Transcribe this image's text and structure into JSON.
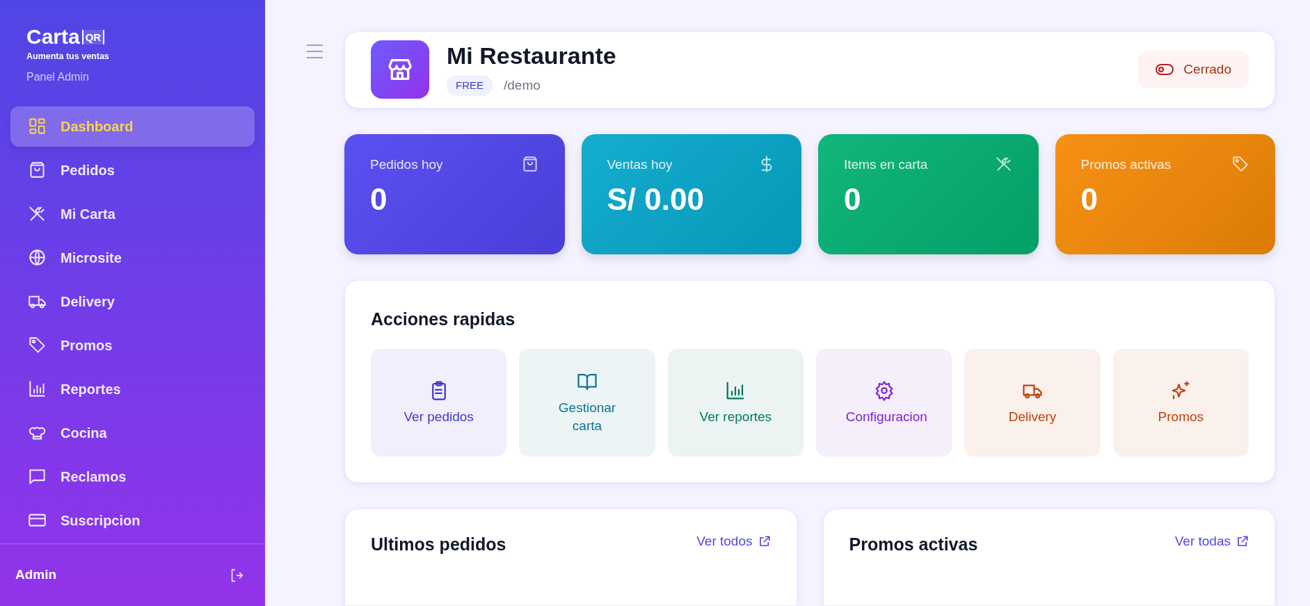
{
  "sidebar": {
    "logo": {
      "name": "Carta",
      "mark": "QR",
      "tagline": "Aumenta tus ventas"
    },
    "subtitle": "Panel Admin",
    "items": [
      {
        "label": "Dashboard",
        "selected": true
      },
      {
        "label": "Pedidos",
        "selected": false
      },
      {
        "label": "Mi Carta",
        "selected": false
      },
      {
        "label": "Microsite",
        "selected": false
      },
      {
        "label": "Delivery",
        "selected": false
      },
      {
        "label": "Promos",
        "selected": false
      },
      {
        "label": "Reportes",
        "selected": false
      },
      {
        "label": "Cocina",
        "selected": false
      },
      {
        "label": "Reclamos",
        "selected": false
      },
      {
        "label": "Suscripcion",
        "selected": false
      }
    ],
    "footer": {
      "user": "Admin"
    }
  },
  "header": {
    "title": "Mi Restaurante",
    "plan": "FREE",
    "slug": "/demo",
    "status": {
      "label": "Cerrado",
      "open": false
    }
  },
  "stats": [
    {
      "label": "Pedidos hoy",
      "value": "0",
      "color": "#5046f0"
    },
    {
      "label": "Ventas hoy",
      "value": "S/ 0.00",
      "color": "#06a8cc"
    },
    {
      "label": "Items en carta",
      "value": "0",
      "color": "#03b173"
    },
    {
      "label": "Promos activas",
      "value": "0",
      "color": "#f58a06"
    }
  ],
  "quick_actions": {
    "title": "Acciones rapidas",
    "items": [
      {
        "label": "Ver pedidos",
        "color": "#4338ca"
      },
      {
        "label": "Gestionar carta",
        "color": "#0e7490"
      },
      {
        "label": "Ver reportes",
        "color": "#047857"
      },
      {
        "label": "Configuracion",
        "color": "#7e22ce"
      },
      {
        "label": "Delivery",
        "color": "#c2410c"
      },
      {
        "label": "Promos",
        "color": "#c2410c"
      }
    ]
  },
  "panels": [
    {
      "title": "Ultimos pedidos",
      "link": "Ver todos"
    },
    {
      "title": "Promos activas",
      "link": "Ver todas"
    }
  ]
}
